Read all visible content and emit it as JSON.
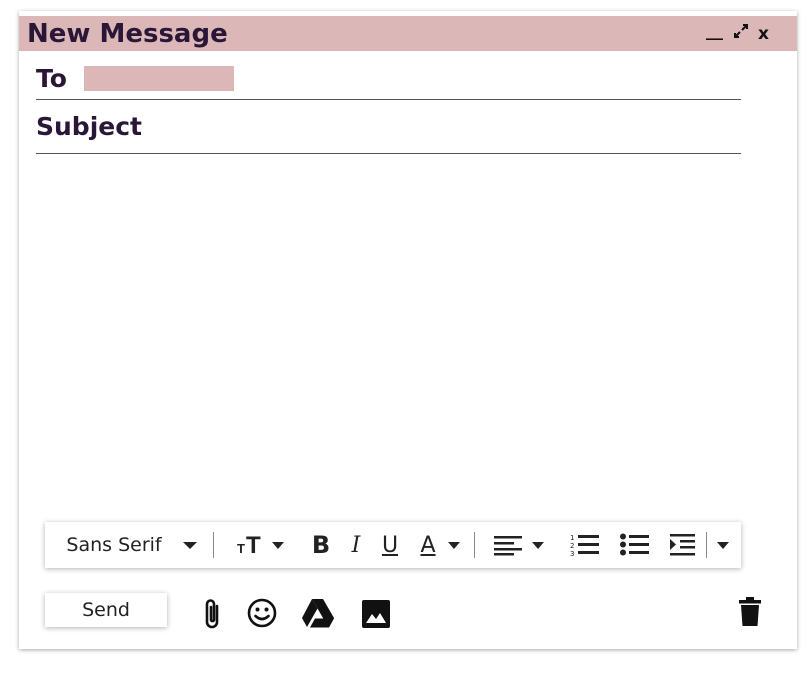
{
  "window": {
    "title": "New Message",
    "controls": {
      "minimize": "__",
      "expand": "↗↙",
      "close": "x"
    }
  },
  "fields": {
    "to_label": "To",
    "to_value": "",
    "subject_label": "Subject",
    "subject_value": ""
  },
  "body": {
    "text": ""
  },
  "toolbar": {
    "font_family": "Sans Serif",
    "font_size_icon": "text-size-icon",
    "bold": "B",
    "italic": "I",
    "underline": "U",
    "text_color": "A",
    "align_icon": "align-left-icon",
    "numbered_list_icon": "numbered-list-icon",
    "bulleted_list_icon": "bulleted-list-icon",
    "indent_icon": "indent-icon",
    "more_icon": "more-options-icon"
  },
  "footer": {
    "send_label": "Send",
    "icons": [
      "attach-icon",
      "emoji-icon",
      "drive-icon",
      "image-icon",
      "trash-icon"
    ]
  },
  "colors": {
    "accent": "#dbb7b8",
    "title_text": "#2a1636"
  }
}
